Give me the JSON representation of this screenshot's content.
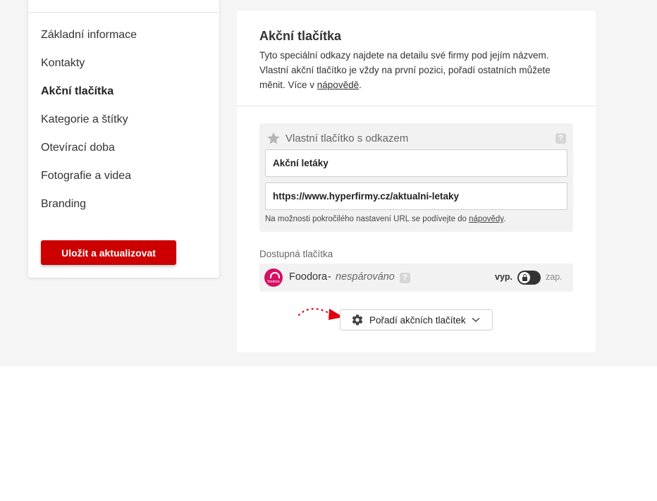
{
  "sidebar": {
    "items": [
      {
        "label": "Základní informace",
        "active": false
      },
      {
        "label": "Kontakty",
        "active": false
      },
      {
        "label": "Akční tlačítka",
        "active": true
      },
      {
        "label": "Kategorie a štítky",
        "active": false
      },
      {
        "label": "Otevírací doba",
        "active": false
      },
      {
        "label": "Fotografie a videa",
        "active": false
      },
      {
        "label": "Branding",
        "active": false
      }
    ],
    "save_label": "Uložit a aktualizovat"
  },
  "main": {
    "title": "Akční tlačítka",
    "description_before_link": "Tyto speciální odkazy najdete na detailu své firmy pod jejím názvem. Vlastní akční tlačítko je vždy na první pozici, pořadí ostatních můžete měnit. Více v ",
    "description_link": "nápovědě",
    "description_after_link": ".",
    "custom_button": {
      "title": "Vlastní tlačítko s odkazem",
      "icon": "star-icon",
      "help": "?",
      "name_value": "Akční letáky",
      "url_value": "https://www.hyperfirmy.cz/aktualni-letaky",
      "note_before_link": "Na možnosti pokročilého nastavení URL se podívejte do ",
      "note_link": "nápovědy",
      "note_after_link": "."
    },
    "available": {
      "label": "Dostupná tlačítka",
      "items": [
        {
          "name": "Foodora",
          "separator": "-",
          "status": "nespárováno",
          "help": "?",
          "logo_text": "foodora",
          "toggle_off_label": "vyp.",
          "toggle_on_label": "zap.",
          "enabled": false
        }
      ]
    },
    "order_button_label": "Pořadí akčních tlačítek"
  },
  "colors": {
    "accent": "#cc0000",
    "foodora": "#d70f64",
    "page_bg": "#f5f5f5"
  }
}
